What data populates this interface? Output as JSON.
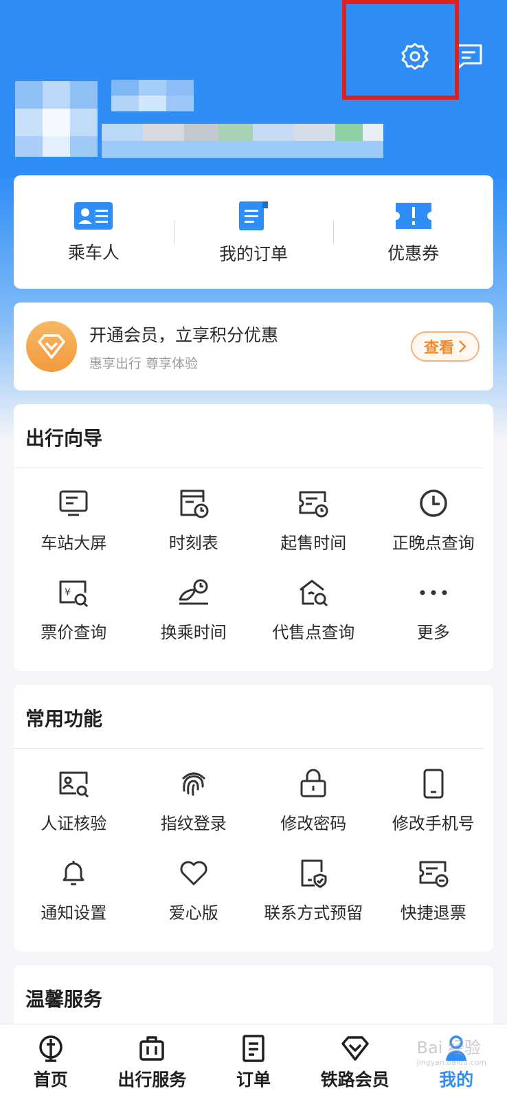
{
  "colors": {
    "primary": "#2f8ef6",
    "accent_orange": "#f08a2e",
    "highlight_red": "#e0201b"
  },
  "header": {
    "icons": [
      "settings-gear-icon",
      "message-icon"
    ]
  },
  "quick_actions": [
    {
      "label": "乘车人",
      "icon": "passenger-card-icon"
    },
    {
      "label": "我的订单",
      "icon": "order-document-icon"
    },
    {
      "label": "优惠券",
      "icon": "coupon-ticket-icon"
    }
  ],
  "membership": {
    "title": "开通会员，立享积分优惠",
    "subtitle": "惠享出行 尊享体验",
    "button": "查看"
  },
  "travel_guide": {
    "title": "出行向导",
    "items": [
      {
        "label": "车站大屏",
        "icon": "station-screen-icon"
      },
      {
        "label": "时刻表",
        "icon": "timetable-icon"
      },
      {
        "label": "起售时间",
        "icon": "sale-time-icon"
      },
      {
        "label": "正晚点查询",
        "icon": "clock-icon"
      },
      {
        "label": "票价查询",
        "icon": "fare-search-icon"
      },
      {
        "label": "换乘时间",
        "icon": "transfer-time-icon"
      },
      {
        "label": "代售点查询",
        "icon": "agency-search-icon"
      },
      {
        "label": "更多",
        "icon": "more-dots-icon"
      }
    ]
  },
  "common_functions": {
    "title": "常用功能",
    "items": [
      {
        "label": "人证核验",
        "icon": "id-verify-icon"
      },
      {
        "label": "指纹登录",
        "icon": "fingerprint-icon"
      },
      {
        "label": "修改密码",
        "icon": "lock-icon"
      },
      {
        "label": "修改手机号",
        "icon": "phone-icon"
      },
      {
        "label": "通知设置",
        "icon": "bell-icon"
      },
      {
        "label": "爱心版",
        "icon": "heart-icon"
      },
      {
        "label": "联系方式预留",
        "icon": "contact-shield-icon"
      },
      {
        "label": "快捷退票",
        "icon": "refund-ticket-icon"
      }
    ]
  },
  "warm_service": {
    "title": "温馨服务"
  },
  "tabbar": [
    {
      "label": "首页",
      "icon": "home-rail-icon"
    },
    {
      "label": "出行服务",
      "icon": "luggage-icon"
    },
    {
      "label": "订单",
      "icon": "order-icon"
    },
    {
      "label": "铁路会员",
      "icon": "member-diamond-icon"
    },
    {
      "label": "我的",
      "icon": "profile-icon",
      "active": true
    }
  ],
  "watermark": {
    "text": "Bai 经验",
    "sub": "jingyan.baidu.com"
  }
}
